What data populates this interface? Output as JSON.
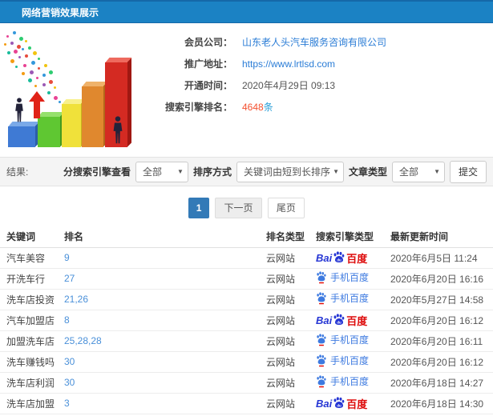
{
  "header": {
    "title": "网络营销效果展示"
  },
  "info": {
    "rows": [
      {
        "label": "会员公司：",
        "value": "山东老人头汽车服务咨询有限公司"
      },
      {
        "label": "推广地址：",
        "value": "https://www.lrtlsd.com"
      },
      {
        "label": "开通时间：",
        "value": "2020年4月29日 09:13"
      },
      {
        "label": "搜索引擎排名：",
        "value": "4648",
        "unit": "条"
      }
    ]
  },
  "filters": {
    "section_label": "结果:",
    "engine_filter_label": "分搜索引擎查看",
    "engine_filter_value": "全部",
    "sort_label": "排序方式",
    "sort_value": "关键词由短到长排序",
    "article_type_label": "文章类型",
    "article_type_value": "全部",
    "submit_label": "提交"
  },
  "pagination": {
    "current": "1",
    "next_label": "下一页",
    "last_label": "尾页"
  },
  "table": {
    "headers": [
      "关键词",
      "排名",
      "排名类型",
      "搜索引擎类型",
      "最新更新时间"
    ],
    "rows": [
      {
        "keyword": "汽车美容",
        "rank": "9",
        "rank_type": "云网站",
        "engine": "baidu",
        "time": "2020年6月5日 11:24"
      },
      {
        "keyword": "开洗车行",
        "rank": "27",
        "rank_type": "云网站",
        "engine": "mobile_baidu",
        "time": "2020年6月20日 16:16"
      },
      {
        "keyword": "洗车店投资",
        "rank": "21,26",
        "rank_type": "云网站",
        "engine": "mobile_baidu",
        "time": "2020年5月27日 14:58"
      },
      {
        "keyword": "汽车加盟店",
        "rank": "8",
        "rank_type": "云网站",
        "engine": "baidu",
        "time": "2020年6月20日 16:12"
      },
      {
        "keyword": "加盟洗车店",
        "rank": "25,28,28",
        "rank_type": "云网站",
        "engine": "mobile_baidu",
        "time": "2020年6月20日 16:11"
      },
      {
        "keyword": "洗车赚钱吗",
        "rank": "30",
        "rank_type": "云网站",
        "engine": "mobile_baidu",
        "time": "2020年6月20日 16:12"
      },
      {
        "keyword": "洗车店利润",
        "rank": "30",
        "rank_type": "云网站",
        "engine": "mobile_baidu",
        "time": "2020年6月18日 14:27"
      },
      {
        "keyword": "洗车店加盟",
        "rank": "3",
        "rank_type": "云网站",
        "engine": "baidu",
        "time": "2020年6月18日 14:30"
      }
    ]
  },
  "logos": {
    "baidu": {
      "prefix": "Bai",
      "suffix": "百度"
    },
    "mobile_baidu": {
      "label": "手机百度"
    }
  },
  "colors": {
    "header_bg": "#1b82c4",
    "link_blue": "#2a7cd6",
    "rank_count_orange": "#f4502f",
    "count_unit_blue": "#2a9fd8",
    "rank_link_blue": "#4a90d9",
    "pagination_active": "#337ab7",
    "baidu_blue": "#2636d4",
    "baidu_red": "#dd0a0a",
    "mobile_baidu_blue": "#3d7ae0"
  }
}
